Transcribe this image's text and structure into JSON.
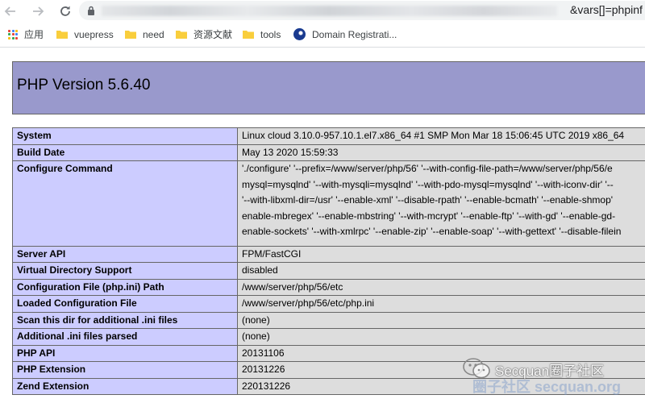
{
  "browser": {
    "url_visible": "&vars[]=phpinf",
    "icons": {
      "back": "back-arrow-icon",
      "forward": "forward-arrow-icon",
      "reload": "reload-icon",
      "lock": "lock-icon"
    }
  },
  "bookmarks": [
    {
      "label": "应用",
      "icon": "apps-grid-icon"
    },
    {
      "label": "vuepress",
      "icon": "folder-icon"
    },
    {
      "label": "need",
      "icon": "folder-icon"
    },
    {
      "label": "资源文献",
      "icon": "folder-icon"
    },
    {
      "label": "tools",
      "icon": "folder-icon"
    },
    {
      "label": "Domain Registrati...",
      "icon": "globe-icon"
    }
  ],
  "page": {
    "title": "PHP Version 5.6.40",
    "rows": [
      {
        "key": "System",
        "value": [
          "Linux cloud 3.10.0-957.10.1.el7.x86_64 #1 SMP Mon Mar 18 15:06:45 UTC 2019 x86_64"
        ]
      },
      {
        "key": "Build Date",
        "value": [
          "May 13 2020 15:59:33"
        ]
      },
      {
        "key": "Configure Command",
        "value": [
          "'./configure' '--prefix=/www/server/php/56' '--with-config-file-path=/www/server/php/56/e",
          "mysql=mysqlnd' '--with-mysqli=mysqlnd' '--with-pdo-mysql=mysqlnd' '--with-iconv-dir' '--",
          "'--with-libxml-dir=/usr' '--enable-xml' '--disable-rpath' '--enable-bcmath' '--enable-shmop'",
          "enable-mbregex' '--enable-mbstring' '--with-mcrypt' '--enable-ftp' '--with-gd' '--enable-gd-",
          "enable-sockets' '--with-xmlrpc' '--enable-zip' '--enable-soap' '--with-gettext' '--disable-filein"
        ]
      },
      {
        "key": "Server API",
        "value": [
          "FPM/FastCGI"
        ]
      },
      {
        "key": "Virtual Directory Support",
        "value": [
          "disabled"
        ]
      },
      {
        "key": "Configuration File (php.ini) Path",
        "value": [
          "/www/server/php/56/etc"
        ]
      },
      {
        "key": "Loaded Configuration File",
        "value": [
          "/www/server/php/56/etc/php.ini"
        ]
      },
      {
        "key": "Scan this dir for additional .ini files",
        "value": [
          "(none)"
        ]
      },
      {
        "key": "Additional .ini files parsed",
        "value": [
          "(none)"
        ]
      },
      {
        "key": "PHP API",
        "value": [
          "20131106"
        ]
      },
      {
        "key": "PHP Extension",
        "value": [
          "20131226"
        ]
      },
      {
        "key": "Zend Extension",
        "value": [
          "220131226"
        ]
      }
    ]
  },
  "watermark": {
    "text": "Secquan圈子社区",
    "sub": "圈子社区 secquan.org"
  },
  "colors": {
    "header_bg": "#9999cc",
    "key_bg": "#ccccff",
    "value_bg": "#dddddd",
    "border": "#666666"
  }
}
